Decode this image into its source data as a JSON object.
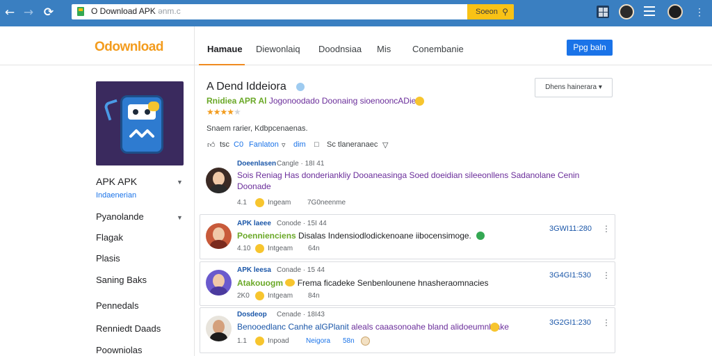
{
  "browser": {
    "url": "O Download APK",
    "url_suffix": "ənm.c",
    "search_label": "Soeon",
    "back_icon": "arrow-left-icon",
    "forward_icon": "arrow-right-icon",
    "reload_icon": "reload-icon",
    "more_icon": "kebab-menu-icon"
  },
  "header": {
    "logo": "Odownload",
    "tabs": [
      "Hamaue",
      "Diewonlaiq",
      "Doodnsiaa",
      "Mis",
      "Conembanie"
    ],
    "active_tab": 0,
    "signup_label": "Ppg baln"
  },
  "sidebar": {
    "items": [
      {
        "label": "APK APK",
        "sub": "Indaenerian",
        "caret": true
      },
      {
        "label": "Pyanolande",
        "caret": true
      },
      {
        "label": "Flagak"
      },
      {
        "label": "Plasis"
      },
      {
        "label": "Saning Baks"
      },
      {
        "label": "Pennedals"
      },
      {
        "label": "Renniedt Daads"
      },
      {
        "label": "Poowniolas"
      }
    ]
  },
  "app": {
    "title": "A Dend Iddeiora",
    "subtitle_lead": "Rnidiea APR Al",
    "subtitle": "Jogonoodado Doonaing sioenooncADie:",
    "rating_stars": 3.5,
    "meta": "Snaem rarier, Kdbpcenaenas.",
    "actions": {
      "like": "tsc",
      "comment_count": "C0",
      "comment_label": "Fanlaton",
      "save_label": "dim",
      "share_label": "Sc tlaneranaec"
    },
    "sort_label": "Dhens hainerara"
  },
  "comments": [
    {
      "name": "Doeenlasen",
      "date": "Cangle · 18I 41",
      "lead": "",
      "body": "Sois Reniag Has donderiankliy Dooaneasinga Soed doeidian sileeonllens Sadanolane Cenin",
      "body2": "Doonade",
      "rating": "4.1",
      "reply": "Ingeam",
      "time_ago": "7G0neenme",
      "timestamp": ""
    },
    {
      "name": "APK laeee",
      "date": "Conode · 15I 44",
      "lead": "Poennienciens",
      "body": "Disalas Indensiodlodickenoane iibocensimoge.",
      "rating": "4.10",
      "reply": "Intgeam",
      "time_ago": "64n",
      "timestamp": "3GWI11:280"
    },
    {
      "name": "APK leesa",
      "date": "Conade · 15 44",
      "lead": "Atakouogm",
      "body": "Frema ficadeke Senbenlounene hnasheraomnacies",
      "rating": "2K0",
      "reply": "Intgeam",
      "time_ago": "84n",
      "timestamp": "3G4GI1:530"
    },
    {
      "name": "Dosdeop",
      "date": "Cenade · 18I43",
      "lead": "Benooedlanc Canhe alGPlanit",
      "body": "aleals caaasonoahe bland alidoeumnloake",
      "rating": "1.1",
      "reply": "Inpoad",
      "mention": "Neigora",
      "time_ago": "58n",
      "timestamp": "3G2GI1:230"
    }
  ]
}
